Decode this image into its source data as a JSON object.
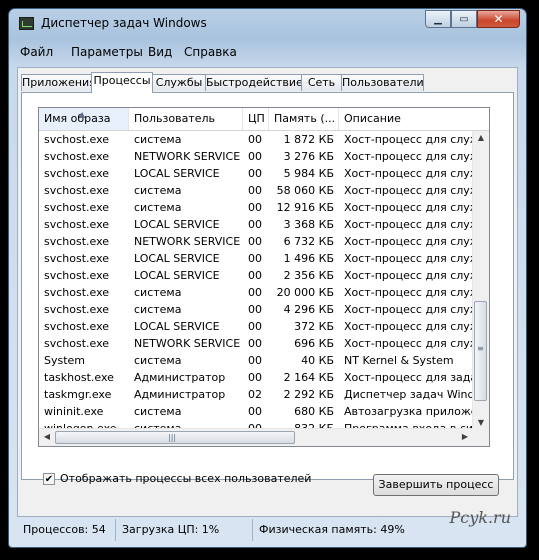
{
  "window": {
    "title": "Диспетчер задач Windows"
  },
  "menu": [
    "Файл",
    "Параметры",
    "Вид",
    "Справка"
  ],
  "tabs": [
    "Приложения",
    "Процессы",
    "Службы",
    "Быстродействие",
    "Сеть",
    "Пользователи"
  ],
  "active_tab": "Процессы",
  "columns": [
    "Имя образа",
    "Пользователь",
    "ЦП",
    "Память (...",
    "Описание"
  ],
  "sorted_column": "Имя образа",
  "processes": [
    {
      "name": "svchost.exe",
      "user": "система",
      "cpu": "00",
      "mem": "1 872 КБ",
      "desc": "Хост-процесс для служб"
    },
    {
      "name": "svchost.exe",
      "user": "NETWORK SERVICE",
      "cpu": "00",
      "mem": "3 276 КБ",
      "desc": "Хост-процесс для служб"
    },
    {
      "name": "svchost.exe",
      "user": "LOCAL SERVICE",
      "cpu": "00",
      "mem": "5 984 КБ",
      "desc": "Хост-процесс для служб"
    },
    {
      "name": "svchost.exe",
      "user": "система",
      "cpu": "00",
      "mem": "58 060 КБ",
      "desc": "Хост-процесс для служб"
    },
    {
      "name": "svchost.exe",
      "user": "система",
      "cpu": "00",
      "mem": "12 916 КБ",
      "desc": "Хост-процесс для служб"
    },
    {
      "name": "svchost.exe",
      "user": "LOCAL SERVICE",
      "cpu": "00",
      "mem": "3 368 КБ",
      "desc": "Хост-процесс для служб"
    },
    {
      "name": "svchost.exe",
      "user": "NETWORK SERVICE",
      "cpu": "00",
      "mem": "6 732 КБ",
      "desc": "Хост-процесс для служб"
    },
    {
      "name": "svchost.exe",
      "user": "LOCAL SERVICE",
      "cpu": "00",
      "mem": "1 496 КБ",
      "desc": "Хост-процесс для служб"
    },
    {
      "name": "svchost.exe",
      "user": "LOCAL SERVICE",
      "cpu": "00",
      "mem": "2 356 КБ",
      "desc": "Хост-процесс для служб"
    },
    {
      "name": "svchost.exe",
      "user": "система",
      "cpu": "00",
      "mem": "20 000 КБ",
      "desc": "Хост-процесс для служб"
    },
    {
      "name": "svchost.exe",
      "user": "система",
      "cpu": "00",
      "mem": "4 296 КБ",
      "desc": "Хост-процесс для служб"
    },
    {
      "name": "svchost.exe",
      "user": "LOCAL SERVICE",
      "cpu": "00",
      "mem": "372 КБ",
      "desc": "Хост-процесс для служб"
    },
    {
      "name": "svchost.exe",
      "user": "NETWORK SERVICE",
      "cpu": "00",
      "mem": "696 КБ",
      "desc": "Хост-процесс для служб"
    },
    {
      "name": "System",
      "user": "система",
      "cpu": "00",
      "mem": "40 КБ",
      "desc": "NT Kernel & System"
    },
    {
      "name": "taskhost.exe",
      "user": "Администратор",
      "cpu": "00",
      "mem": "2 164 КБ",
      "desc": "Хост-процесс для задач"
    },
    {
      "name": "taskmgr.exe",
      "user": "Администратор",
      "cpu": "02",
      "mem": "2 292 КБ",
      "desc": "Диспетчер задач Windows"
    },
    {
      "name": "wininit.exe",
      "user": "система",
      "cpu": "00",
      "mem": "680 КБ",
      "desc": "Автозагрузка приложений"
    },
    {
      "name": "winlogon.exe",
      "user": "система",
      "cpu": "00",
      "mem": "832 КБ",
      "desc": "Программа входа в систему"
    }
  ],
  "show_all_checkbox": {
    "label": "Отображать процессы всех пользователей",
    "checked": true
  },
  "end_process_button": "Завершить процесс",
  "status": {
    "processes": "Процессов: 54",
    "cpu": "Загрузка ЦП: 1%",
    "memory": "Физическая память: 49%"
  },
  "watermark": "Pcyk.ru"
}
